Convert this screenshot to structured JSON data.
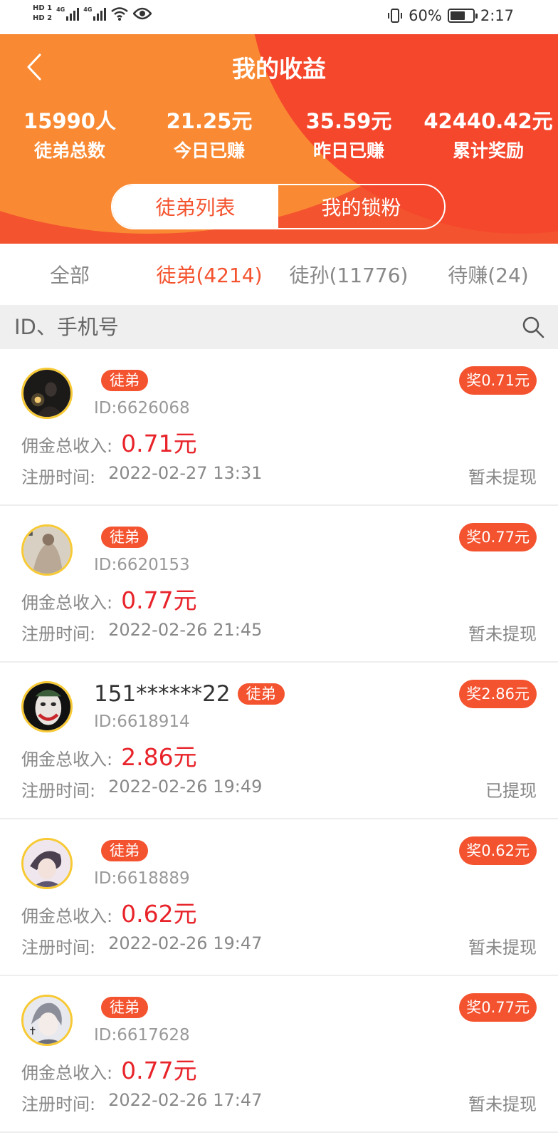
{
  "status_bar": {
    "hd1": "HD 1",
    "hd2": "HD 2",
    "net1": "4G",
    "net2": "4G",
    "battery": "60%",
    "time": "2:17"
  },
  "header": {
    "title": "我的收益",
    "stats": [
      {
        "value": "15990人",
        "label": "徒弟总数"
      },
      {
        "value": "21.25元",
        "label": "今日已赚"
      },
      {
        "value": "35.59元",
        "label": "昨日已赚"
      },
      {
        "value": "42440.42元",
        "label": "累计奖励"
      }
    ],
    "segments": [
      "徒弟列表",
      "我的锁粉"
    ]
  },
  "tabs": [
    "全部",
    "徒弟(4214)",
    "徒孙(11776)",
    "待赚(24)"
  ],
  "search": {
    "placeholder": "ID、手机号"
  },
  "list_labels": {
    "income": "佣金总收入:",
    "register": "注册时间:"
  },
  "items": [
    {
      "name": "",
      "badge": "徒弟",
      "reward": "奖0.71元",
      "id": "ID:6626068",
      "income": "0.71元",
      "time": "2022-02-27 13:31",
      "status": "暂未提现"
    },
    {
      "name": "",
      "badge": "徒弟",
      "reward": "奖0.77元",
      "id": "ID:6620153",
      "income": "0.77元",
      "time": "2022-02-26 21:45",
      "status": "暂未提现"
    },
    {
      "name": "151******22",
      "badge": "徒弟",
      "reward": "奖2.86元",
      "id": "ID:6618914",
      "income": "2.86元",
      "time": "2022-02-26 19:49",
      "status": "已提现"
    },
    {
      "name": "",
      "badge": "徒弟",
      "reward": "奖0.62元",
      "id": "ID:6618889",
      "income": "0.62元",
      "time": "2022-02-26 19:47",
      "status": "暂未提现"
    },
    {
      "name": "",
      "badge": "徒弟",
      "reward": "奖0.77元",
      "id": "ID:6617628",
      "income": "0.77元",
      "time": "2022-02-26 17:47",
      "status": "暂未提现"
    }
  ],
  "colors": {
    "accent": "#f4532f",
    "money": "#e8232a",
    "avatar_ring": "#f7c934"
  }
}
